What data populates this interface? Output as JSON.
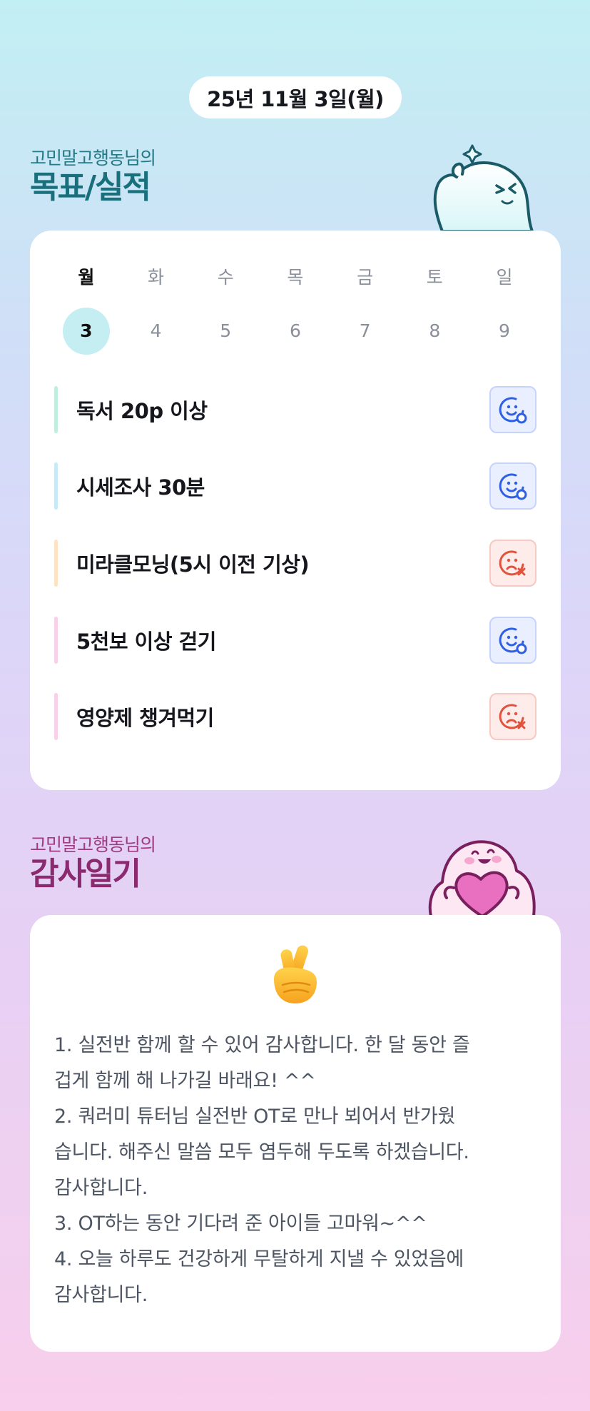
{
  "header": {
    "date": "25년 11월 3일(월)"
  },
  "goals_section": {
    "subtitle": "고민말고행동님의",
    "title": "목표/실적",
    "week": {
      "days": [
        "월",
        "화",
        "수",
        "목",
        "금",
        "토",
        "일"
      ],
      "dates": [
        "3",
        "4",
        "5",
        "6",
        "7",
        "8",
        "9"
      ],
      "selected_index": 0
    },
    "items": [
      {
        "label": "독서 20p 이상",
        "status": "done",
        "bar_color": "#bfeedd"
      },
      {
        "label": "시세조사 30분",
        "status": "done",
        "bar_color": "#c6eaf7"
      },
      {
        "label": "미라클모닝(5시 이전 기상)",
        "status": "fail",
        "bar_color": "#fde3c1"
      },
      {
        "label": "5천보 이상 걷기",
        "status": "done",
        "bar_color": "#f9cfe9"
      },
      {
        "label": "영양제 챙겨먹기",
        "status": "fail",
        "bar_color": "#f9cfe9"
      }
    ],
    "icons": {
      "done": "smile-check-icon",
      "fail": "sad-x-icon"
    }
  },
  "gratitude_section": {
    "subtitle": "고민말고행동님의",
    "title": "감사일기",
    "emoji_icon": "crossed-fingers-icon",
    "entries": [
      "1. 실전반 함께 할 수 있어 감사합니다. 한 달 동안 즐",
      "겁게 함께 해 나가길 바래요! ^^",
      "2. 쿼러미 튜터님 실전반 OT로 만나 뵈어서 반가웠",
      "습니다. 해주신 말씀 모두 염두해 두도록 하겠습니다.",
      "감사합니다.",
      "3. OT하는 동안 기다려 준 아이들 고마워~^^",
      "4. 오늘 하루도 건강하게 무탈하게 지낼 수 있었음에",
      "감사합니다."
    ]
  },
  "colors": {
    "done_icon": "#2f5fe3",
    "fail_icon": "#e2533e",
    "selected_date_bg": "#c5eef3",
    "goals_title": "#1a6f7c",
    "gratitude_title": "#8b2a6e"
  }
}
